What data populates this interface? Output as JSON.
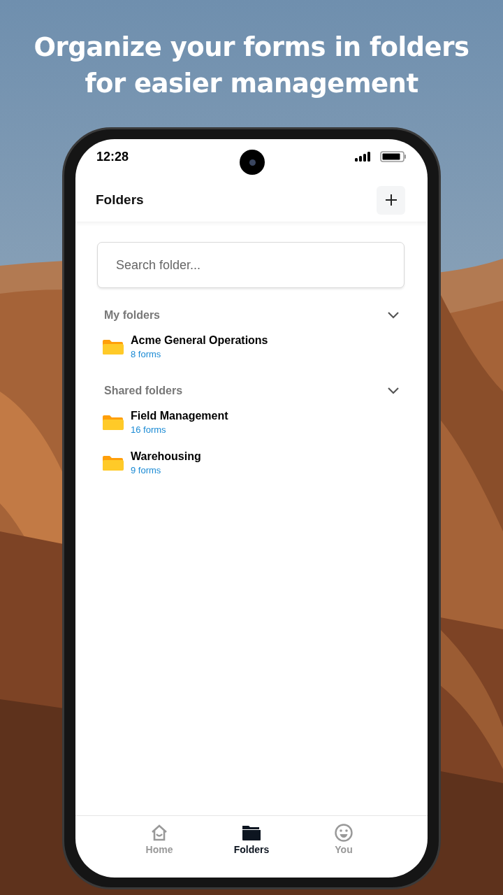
{
  "headline": "Organize your forms in folders for easier management",
  "status_bar": {
    "time": "12:28"
  },
  "header": {
    "title": "Folders"
  },
  "search": {
    "placeholder": "Search folder..."
  },
  "sections": [
    {
      "title": "My folders",
      "expanded": true,
      "folders": [
        {
          "name": "Acme General Operations",
          "count": "8 forms"
        }
      ]
    },
    {
      "title": "Shared folders",
      "expanded": true,
      "folders": [
        {
          "name": "Field Management",
          "count": "16 forms"
        },
        {
          "name": "Warehousing",
          "count": "9 forms"
        }
      ]
    }
  ],
  "tabs": [
    {
      "label": "Home",
      "selected": false
    },
    {
      "label": "Folders",
      "selected": true
    },
    {
      "label": "You",
      "selected": false
    }
  ]
}
